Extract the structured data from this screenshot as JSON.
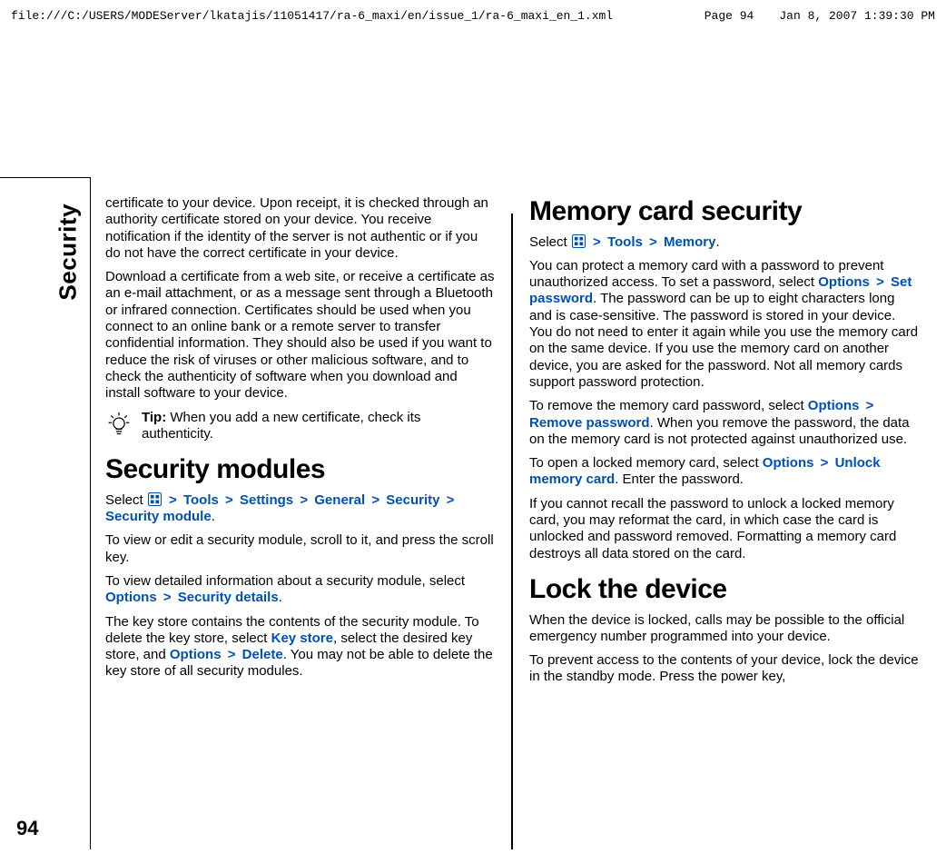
{
  "header": {
    "file_path": "file:///C:/USERS/MODEServer/lkatajis/11051417/ra-6_maxi/en/issue_1/ra-6_maxi_en_1.xml",
    "page_label": "Page 94",
    "timestamp": "Jan 8, 2007 1:39:30 PM"
  },
  "gutter": {
    "section": "Security",
    "page_number": "94"
  },
  "left": {
    "p1": "certificate to your device. Upon receipt, it is checked through an authority certificate stored on your device. You receive notification if the identity of the server is not authentic or if you do not have the correct certificate in your device.",
    "p2": "Download a certificate from a web site, or receive a certificate as an e-mail attachment, or as a message sent through a Bluetooth or infrared connection. Certificates should be used when you connect to an online bank or a remote server to transfer confidential information. They should also be used if you want to reduce the risk of viruses or other malicious software, and to check the authenticity of software when you download and install software to your device.",
    "tip_label": "Tip: ",
    "tip_body": "When you add a new certificate, check its authenticity.",
    "h_secmod": "Security modules",
    "sel1_a": "Select ",
    "tools": "Tools",
    "settings": "Settings",
    "general": "General",
    "security": "Security",
    "sec_module": "Security module",
    "p3": "To view or edit a security module, scroll to it, and press the scroll key.",
    "p4_a": "To view detailed information about a security module, select ",
    "options": "Options",
    "sec_details": "Security details",
    "p5_a": "The key store contains the contents of the security module. To delete the key store, select ",
    "keystore": "Key store",
    "p5_b": ", select the desired key store, and ",
    "delete": "Delete",
    "p5_c": ". You may not be able to delete the key store of all security modules."
  },
  "right": {
    "h_mem": "Memory card security",
    "sel_a": "Select ",
    "tools": "Tools",
    "memory": "Memory",
    "p1_a": "You can protect a memory card with a password to prevent unauthorized access. To set a password, select ",
    "options": "Options",
    "set_pwd": "Set password",
    "p1_b": ". The password can be up to eight characters long and is case-sensitive. The password is stored in your device. You do not need to enter it again while you use the memory card on the same device. If you use the memory card on another device, you are asked for the password. Not all memory cards support password protection.",
    "p2_a": "To remove the memory card password, select ",
    "remove_pwd": "Remove password",
    "p2_b": ". When you remove the password, the data on the memory card is not protected against unauthorized use.",
    "p3_a": "To open a locked memory card, select ",
    "unlock": "Unlock memory card",
    "p3_b": ". Enter the password.",
    "p4": "If you cannot recall the password to unlock a locked memory card, you may reformat the card, in which case the card is unlocked and password removed. Formatting a memory card destroys all data stored on the card.",
    "h_lock": "Lock the device",
    "p5": "When the device is locked, calls may be possible to the official emergency number programmed into your device.",
    "p6": "To prevent access to the contents of your device, lock the device in the standby mode. Press the power key,"
  },
  "glyphs": {
    "gt": ">",
    "period": "."
  }
}
